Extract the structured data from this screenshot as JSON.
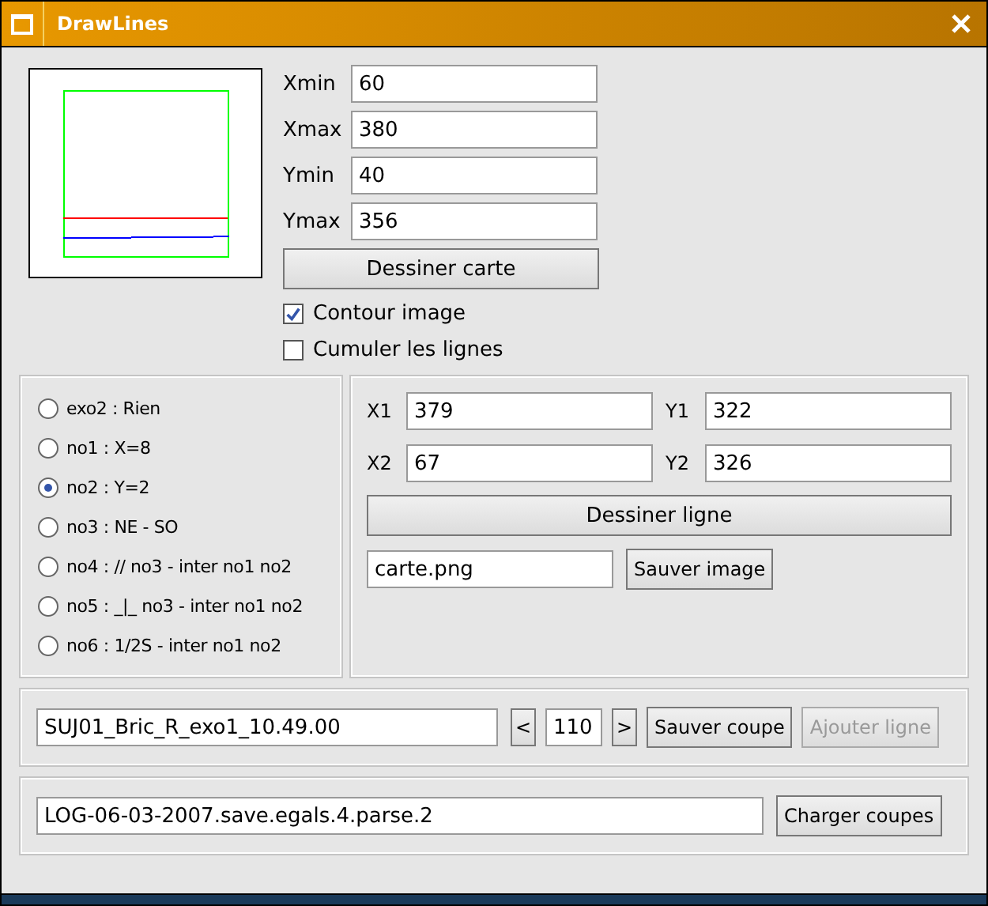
{
  "window": {
    "title": "DrawLines"
  },
  "bounds": [
    {
      "label": "Xmin",
      "value": "60"
    },
    {
      "label": "Xmax",
      "value": "380"
    },
    {
      "label": "Ymin",
      "value": "40"
    },
    {
      "label": "Ymax",
      "value": "356"
    }
  ],
  "draw_map_button": "Dessiner carte",
  "options": [
    {
      "label": "Contour image",
      "checked": true
    },
    {
      "label": "Cumuler les lignes",
      "checked": false
    }
  ],
  "exercises": [
    {
      "label": "exo2 : Rien",
      "selected": false
    },
    {
      "label": "no1 : X=8",
      "selected": false
    },
    {
      "label": "no2 : Y=2",
      "selected": true
    },
    {
      "label": "no3 : NE - SO",
      "selected": false
    },
    {
      "label": "no4 : // no3 - inter no1 no2",
      "selected": false
    },
    {
      "label": "no5 : _|_ no3 - inter no1 no2",
      "selected": false
    },
    {
      "label": "no6 : 1/2S - inter no1 no2",
      "selected": false
    }
  ],
  "coords": [
    {
      "label": "X1",
      "value": "379"
    },
    {
      "label": "Y1",
      "value": "322"
    },
    {
      "label": "X2",
      "value": "67"
    },
    {
      "label": "Y2",
      "value": "326"
    }
  ],
  "draw_line_button": "Dessiner ligne",
  "image_file": "carte.png",
  "save_image_button": "Sauver image",
  "cut": {
    "name": "SUJ01_Bric_R_exo1_10.49.00",
    "prev": "<",
    "index": "110",
    "next": ">",
    "save": "Sauver coupe",
    "add": "Ajouter ligne",
    "add_disabled": true
  },
  "log": {
    "file": "LOG-06-03-2007.save.egals.4.parse.2",
    "load": "Charger coupes"
  }
}
